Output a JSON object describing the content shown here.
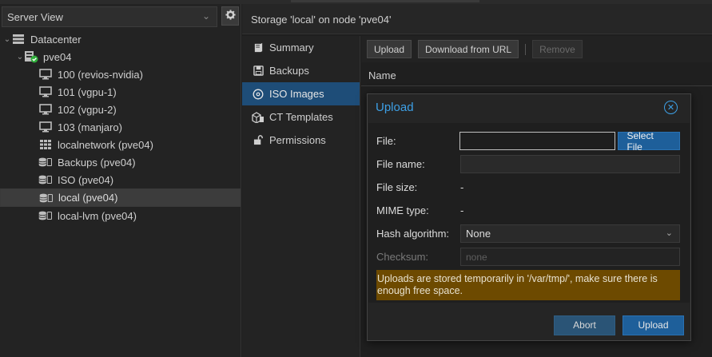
{
  "colors": {
    "accent": "#1e5f9a",
    "title_blue": "#3da0e6",
    "warning_bg": "#6d4a00",
    "selected_nav": "#1e4d78"
  },
  "left": {
    "view_label": "Server View",
    "tree": [
      {
        "label": "Datacenter",
        "icon": "datacenter-icon"
      },
      {
        "label": "pve04",
        "icon": "node-online-icon"
      },
      {
        "label": "100 (revios-nvidia)",
        "icon": "vm-icon"
      },
      {
        "label": "101 (vgpu-1)",
        "icon": "vm-icon"
      },
      {
        "label": "102 (vgpu-2)",
        "icon": "vm-icon"
      },
      {
        "label": "103 (manjaro)",
        "icon": "vm-icon"
      },
      {
        "label": "localnetwork (pve04)",
        "icon": "network-grid-icon"
      },
      {
        "label": "Backups (pve04)",
        "icon": "storage-icon"
      },
      {
        "label": "ISO (pve04)",
        "icon": "storage-icon"
      },
      {
        "label": "local (pve04)",
        "icon": "storage-icon"
      },
      {
        "label": "local-lvm (pve04)",
        "icon": "storage-icon"
      }
    ]
  },
  "main": {
    "title": "Storage 'local' on node 'pve04'",
    "nav": [
      {
        "label": "Summary",
        "icon": "book-icon"
      },
      {
        "label": "Backups",
        "icon": "floppy-icon"
      },
      {
        "label": "ISO Images",
        "icon": "disc-icon"
      },
      {
        "label": "CT Templates",
        "icon": "cube-icon"
      },
      {
        "label": "Permissions",
        "icon": "unlock-icon"
      }
    ],
    "toolbar": {
      "upload": "Upload",
      "download": "Download from URL",
      "remove": "Remove"
    },
    "column": "Name"
  },
  "dialog": {
    "title": "Upload",
    "file_label": "File:",
    "file_value": "",
    "select_file": "Select File",
    "filename_label": "File name:",
    "filename_value": "",
    "filesize_label": "File size:",
    "filesize_value": "-",
    "mime_label": "MIME type:",
    "mime_value": "-",
    "hash_label": "Hash algorithm:",
    "hash_value": "None",
    "checksum_label": "Checksum:",
    "checksum_placeholder": "none",
    "warning": "Uploads are stored temporarily in '/var/tmp/', make sure there is enough free space.",
    "abort": "Abort",
    "upload": "Upload"
  }
}
